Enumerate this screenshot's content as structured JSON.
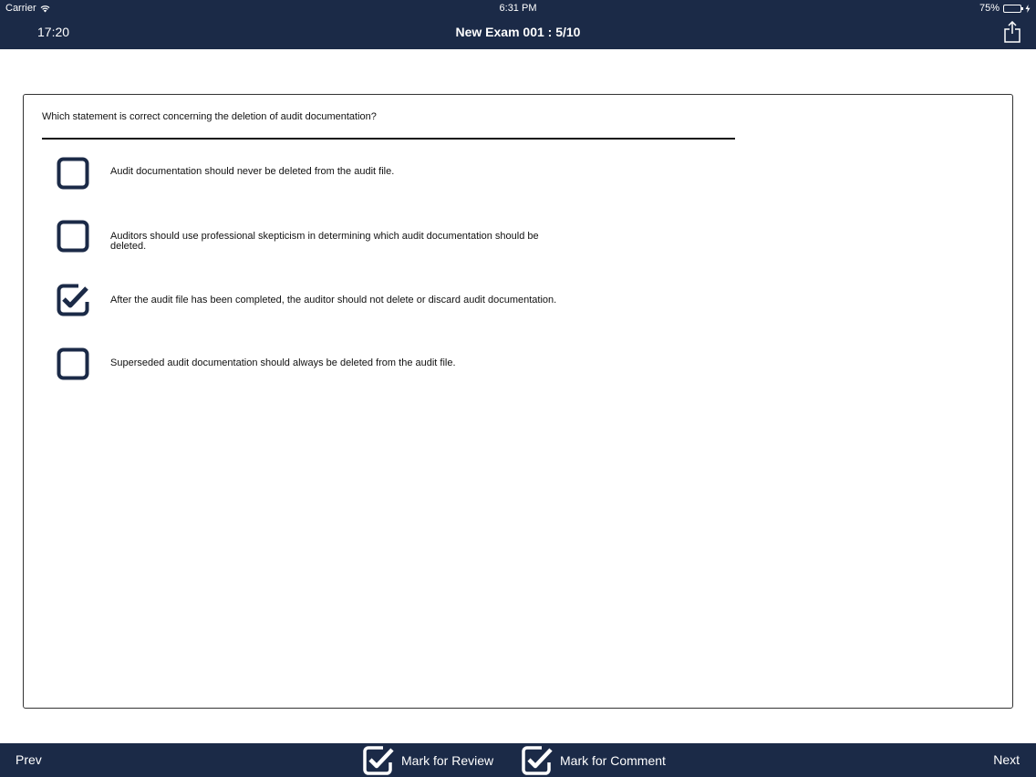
{
  "status_bar": {
    "carrier": "Carrier",
    "time": "6:31 PM",
    "battery_percent": "75%",
    "battery_level": 0.75,
    "battery_color": "#4cd964"
  },
  "nav": {
    "timer": "17:20",
    "title": "New Exam 001 : 5/10",
    "share_icon": "share-icon"
  },
  "question": {
    "text": "Which statement is correct concerning the deletion of audit documentation?",
    "options": [
      {
        "text": "Audit documentation should never be deleted from the audit file.",
        "checked": false
      },
      {
        "text": "Auditors should use professional skepticism in determining which audit documentation should be deleted.",
        "checked": false
      },
      {
        "text": "After the audit file has been completed, the auditor should not delete or discard audit documentation.",
        "checked": true
      },
      {
        "text": "Superseded audit documentation should always be deleted from the audit file.",
        "checked": false
      }
    ]
  },
  "bottom_bar": {
    "prev_label": "Prev",
    "review_label": "Mark for Review",
    "comment_label": "Mark for Comment",
    "next_label": "Next"
  },
  "colors": {
    "bar_background": "#1b2a47",
    "checkbox_stroke": "#1b2a47"
  }
}
